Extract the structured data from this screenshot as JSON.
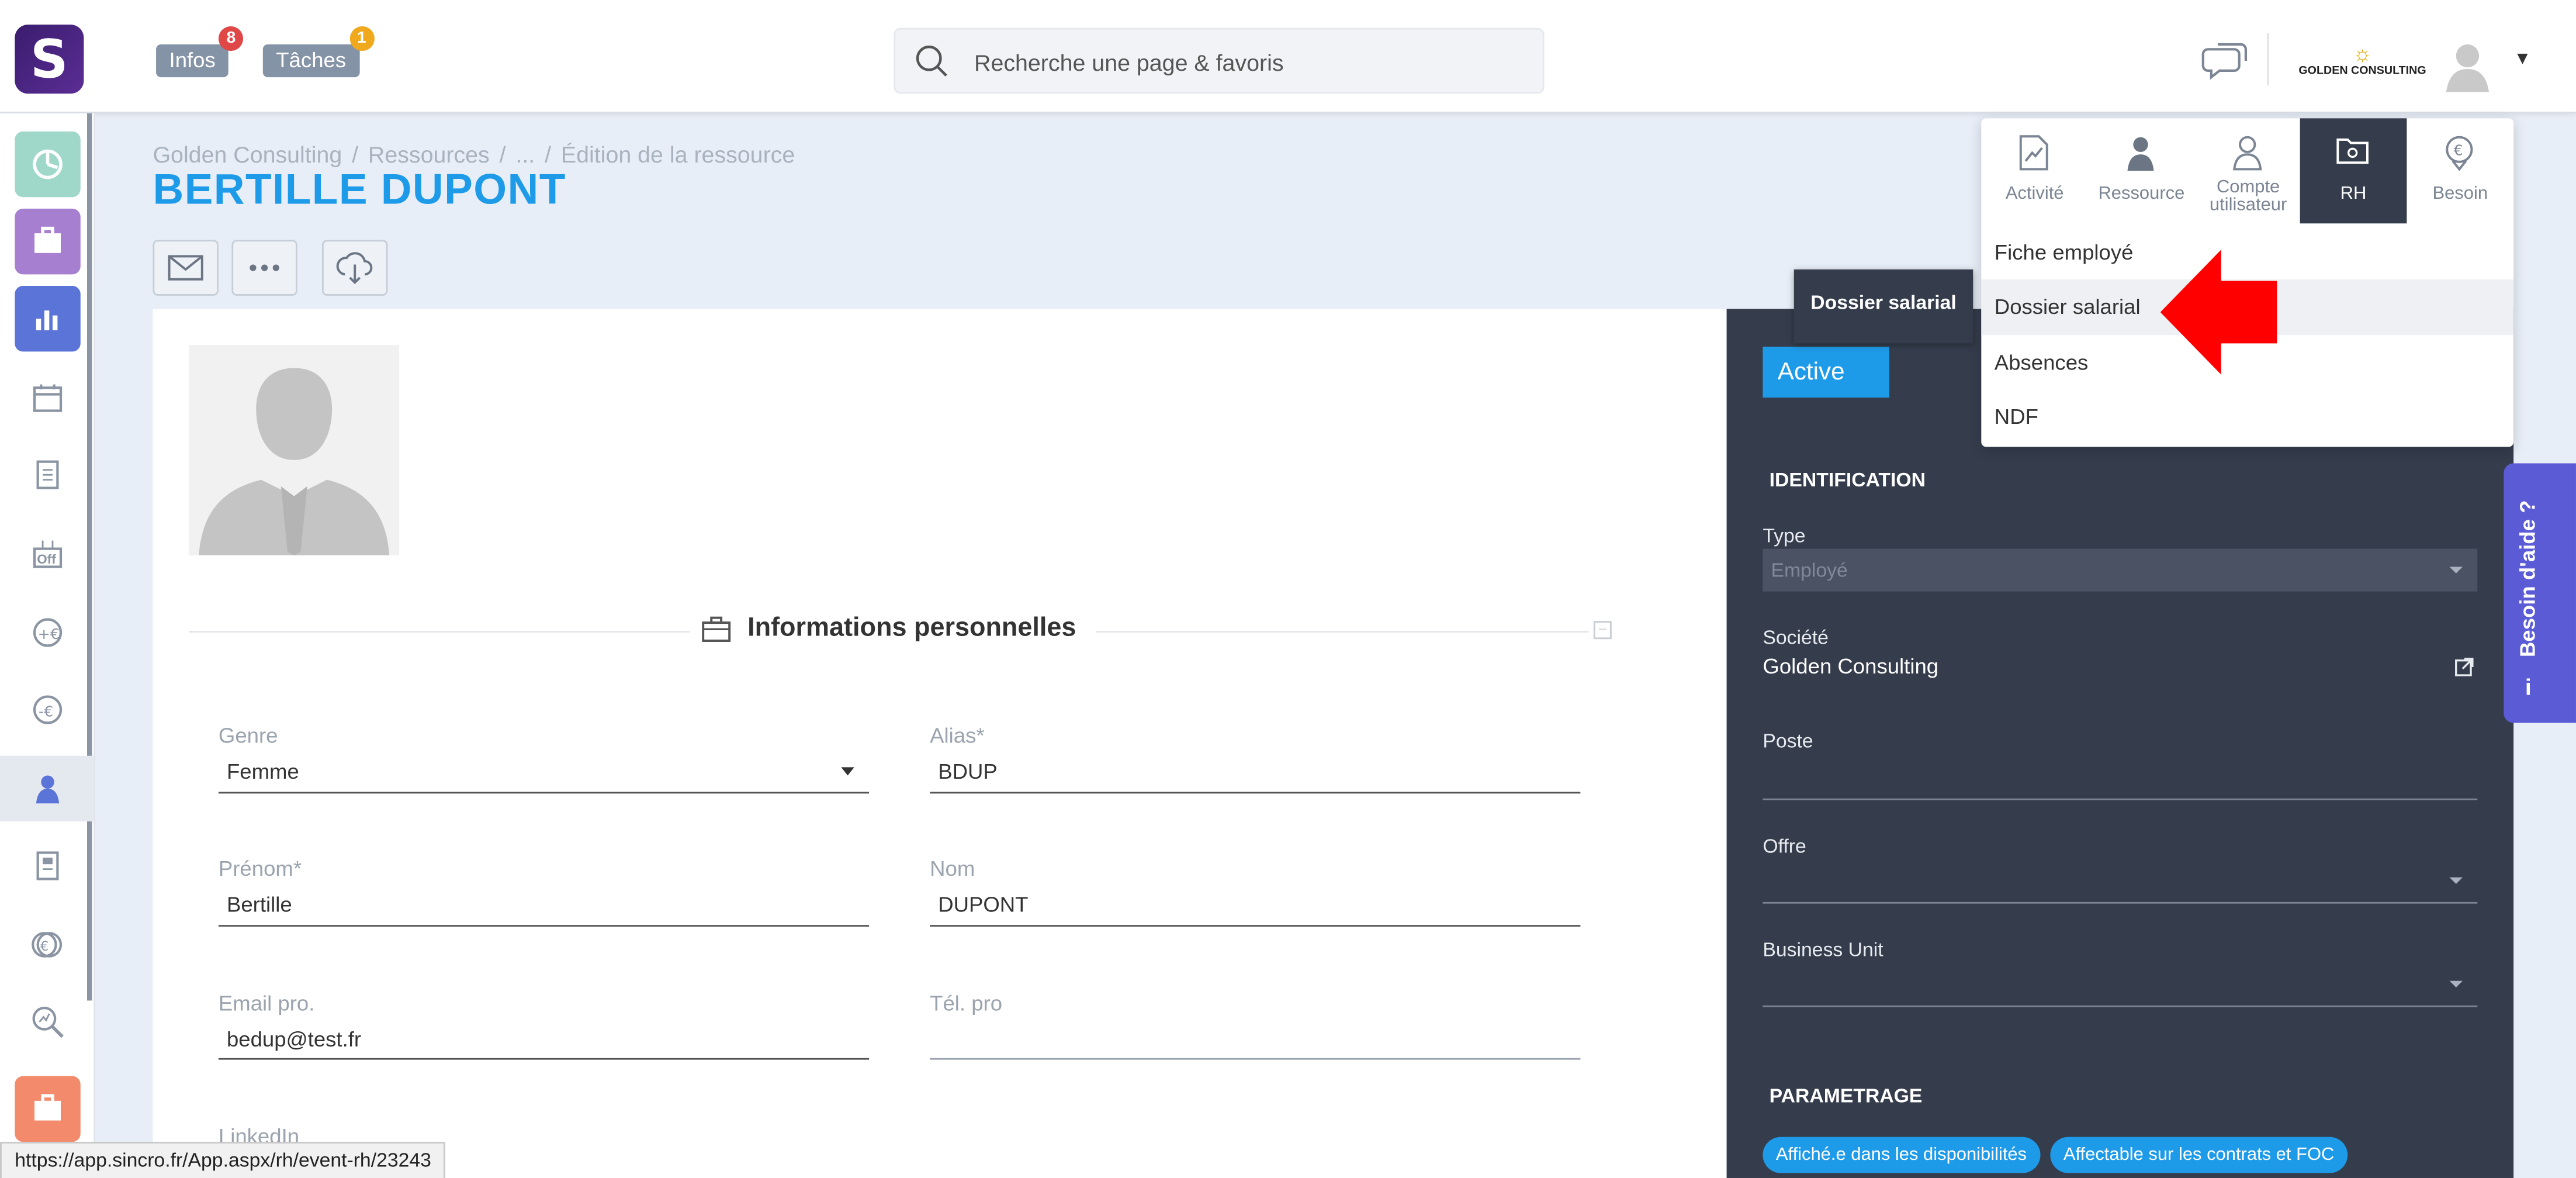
{
  "topbar": {
    "logo_letter": "S",
    "infos_label": "Infos",
    "infos_count": "8",
    "taches_label": "Tâches",
    "taches_count": "1",
    "search_placeholder": "Recherche une page & favoris",
    "company_name": "GOLDEN CONSULTING"
  },
  "leftnav": {
    "items": [
      {
        "icon": "dashboard-icon",
        "color": "#9fd8c8"
      },
      {
        "icon": "briefcase-icon",
        "color": "#a77fd0"
      },
      {
        "icon": "bar-chart-icon",
        "color": "#5b74d8"
      },
      {
        "icon": "calendar-icon"
      },
      {
        "icon": "document-icon"
      },
      {
        "icon": "off-icon"
      },
      {
        "icon": "plus-euro-icon"
      },
      {
        "icon": "minus-euro-icon"
      },
      {
        "icon": "resource-person-icon"
      },
      {
        "icon": "receipt-icon"
      },
      {
        "icon": "euro-circle-icon"
      },
      {
        "icon": "analytics-search-icon"
      },
      {
        "icon": "orange-briefcase-icon",
        "color": "#f28a6b"
      }
    ]
  },
  "breadcrumb": {
    "items": [
      "Golden Consulting",
      "Ressources",
      "...",
      "Édition de la ressource"
    ]
  },
  "page_title": "BERTILLE DUPONT",
  "section": {
    "title": "Informations personnelles",
    "collapse_symbol": "–"
  },
  "fields": {
    "genre": {
      "label": "Genre",
      "value": "Femme"
    },
    "alias": {
      "label": "Alias*",
      "value": "BDUP"
    },
    "prenom": {
      "label": "Prénom*",
      "value": "Bertille"
    },
    "nom": {
      "label": "Nom",
      "value": "DUPONT"
    },
    "email": {
      "label": "Email pro.",
      "value": "bedup@test.fr"
    },
    "tel": {
      "label": "Tél. pro",
      "value": ""
    },
    "linkedin": {
      "label": "LinkedIn"
    }
  },
  "right_panel": {
    "status": "Active",
    "identification_heading": "IDENTIFICATION",
    "type_label": "Type",
    "type_value": "Employé",
    "societe_label": "Société",
    "societe_value": "Golden Consulting",
    "poste_label": "Poste",
    "offre_label": "Offre",
    "bu_label": "Business Unit",
    "parametrage_heading": "PARAMETRAGE",
    "chips": [
      "Affiché.e dans les disponibilités",
      "Affectable sur les contrats et FOC"
    ]
  },
  "tooltip": "Dossier salarial",
  "dropdown": {
    "tabs": [
      {
        "label": "Activité",
        "icon": "activity-chart-icon",
        "active": false
      },
      {
        "label": "Ressource",
        "icon": "person-icon",
        "active": false
      },
      {
        "label": "Compte utilisateur",
        "icon": "user-account-icon",
        "active": false
      },
      {
        "label": "RH",
        "icon": "folder-icon",
        "active": true
      },
      {
        "label": "Besoin",
        "icon": "euro-pin-icon",
        "active": false
      }
    ],
    "items": [
      "Fiche employé",
      "Dossier salarial",
      "Absences",
      "NDF"
    ],
    "highlighted_index": 1
  },
  "help_tab": {
    "label": "Besoin d'aide ?",
    "icon": "i"
  },
  "status_bar": {
    "url": "https://app.sincro.fr/App.aspx/rh/event-rh/23243"
  },
  "colors": {
    "accent_blue": "#1e9be8",
    "panel_dark": "#353d4d",
    "help_purple": "#5b5bd6",
    "arrow_red": "#ff0000",
    "badge_red": "#e04848",
    "badge_orange": "#f0a81c"
  }
}
